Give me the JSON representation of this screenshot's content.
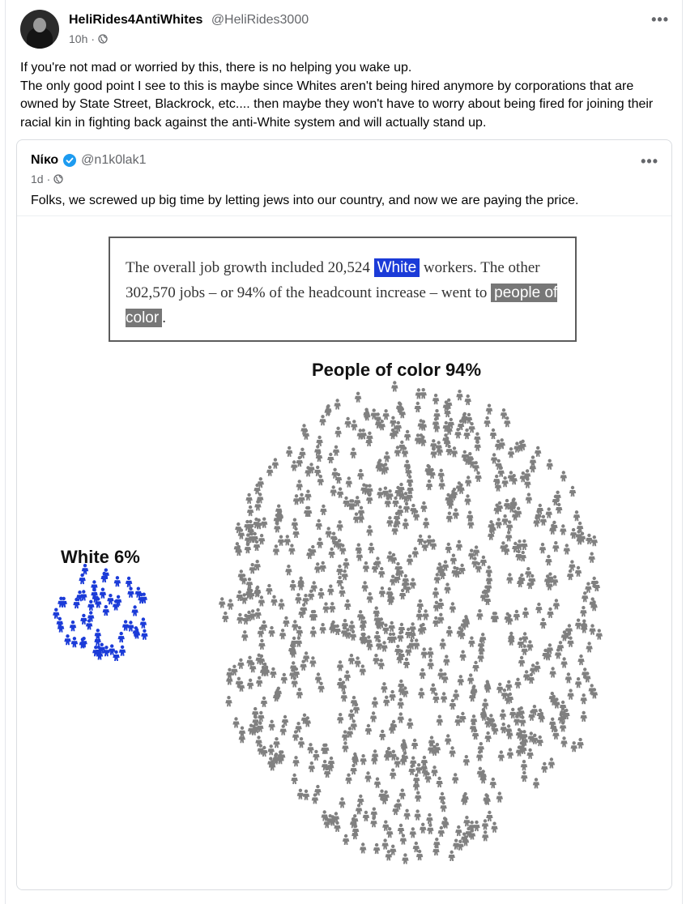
{
  "post": {
    "author_name": "HeliRides4AntiWhites",
    "author_handle": "@HeliRides3000",
    "time": "10h",
    "visibility_icon": "globe-icon",
    "more_icon": "more-options-icon",
    "text_line1": "If you're not mad or worried by this, there is no helping you wake up.",
    "text_line2": "The only good point I see to this is maybe since Whites aren't being hired anymore by corporations that are owned by State Street, Blackrock, etc.... then maybe they won't have to worry about being fired for joining their racial kin in fighting back against the anti-White system and will actually stand up."
  },
  "shared_post": {
    "author_name": "Νίκο",
    "author_handle": "@n1k0lak1",
    "verified_icon": "verified-badge-icon",
    "time": "1d",
    "text": "Folks, we screwed up big time by letting jews into our country, and now we are paying the price."
  },
  "infographic": {
    "quote_pre": "The overall job growth included 20,524 ",
    "quote_white": "White",
    "quote_mid": " workers. The other 302,570 jobs – or 94% of the headcount increase – went to ",
    "quote_poc": "people of color",
    "quote_end": "."
  },
  "chart_data": {
    "type": "pictogram",
    "title": "",
    "categories": [
      "White",
      "People of color"
    ],
    "series": [
      {
        "name": "White 6%",
        "values": [
          6
        ],
        "count": 20524,
        "color": "#1b3bd8"
      },
      {
        "name": "People of color 94%",
        "values": [
          94
        ],
        "count": 302570,
        "color": "#808080"
      }
    ],
    "labels": [
      "White 6%",
      "People of color 94%"
    ]
  },
  "colors": {
    "white_group": "#1b3bd8",
    "poc_group": "#808080"
  }
}
